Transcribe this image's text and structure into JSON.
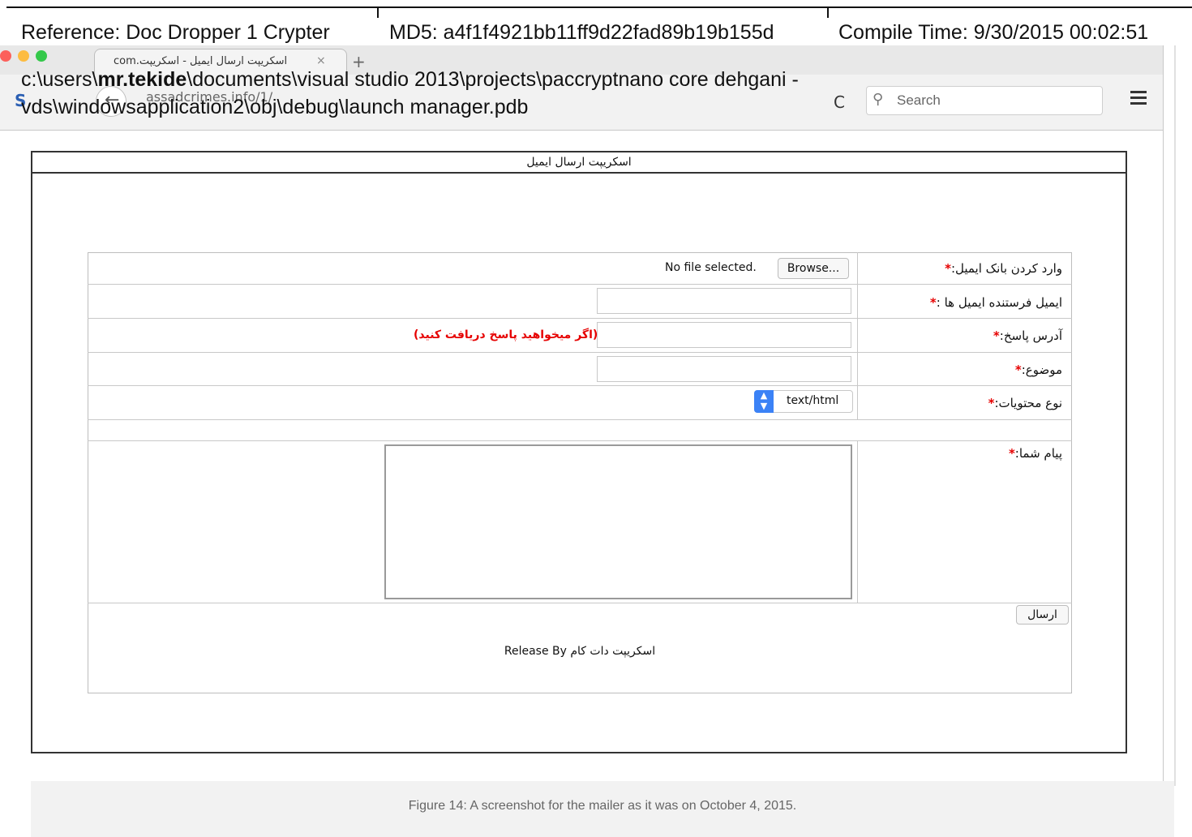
{
  "annotation": {
    "reference": "Reference: Doc Dropper 1 Crypter",
    "md5": "MD5: a4f1f4921bb11ff9d22fad89b19b155d",
    "compile_time": "Compile Time: 9/30/2015 00:02:51",
    "pdb_prefix": "c:\\users\\",
    "pdb_bold": "mr.tekide",
    "pdb_suffix": "\\documents\\visual studio 2013\\projects\\paccryptnano core dehgani -",
    "pdb_line2": "vds\\windowsapplication2\\obj\\debug\\launch manager.pdb"
  },
  "browser": {
    "tab_title": "اسکریپت ارسال ایمیل - اسکریپت.com",
    "tab_close": "×",
    "new_tab": "+",
    "url": "assadcrimes.info/1/",
    "reload": "C",
    "search_placeholder": "Search"
  },
  "page": {
    "header": "اسکریپت ارسال ایمیل",
    "fields": {
      "bank_label": "وارد کردن بانک ایمیل:",
      "browse_button": "Browse...",
      "no_file": "No file selected.",
      "sender_label": "ایمیل فرستنده ایمیل ها :",
      "reply_label": "آدرس پاسخ:",
      "reply_note": "(اگر میخواهید پاسخ دریافت کنید)",
      "subject_label": "موضوع:",
      "content_type_label": "نوع محتویات:",
      "content_type_value": "text/html",
      "message_label": "پیام شما:",
      "required_mark": "*",
      "send_button": "ارسال"
    },
    "footer": "اسکریپت دات کام Release By"
  },
  "caption": "Figure 14: A screenshot for the mailer as it was on October 4, 2015.",
  "colors": {
    "required": "#e60000",
    "select_accent": "#3b82f6"
  }
}
